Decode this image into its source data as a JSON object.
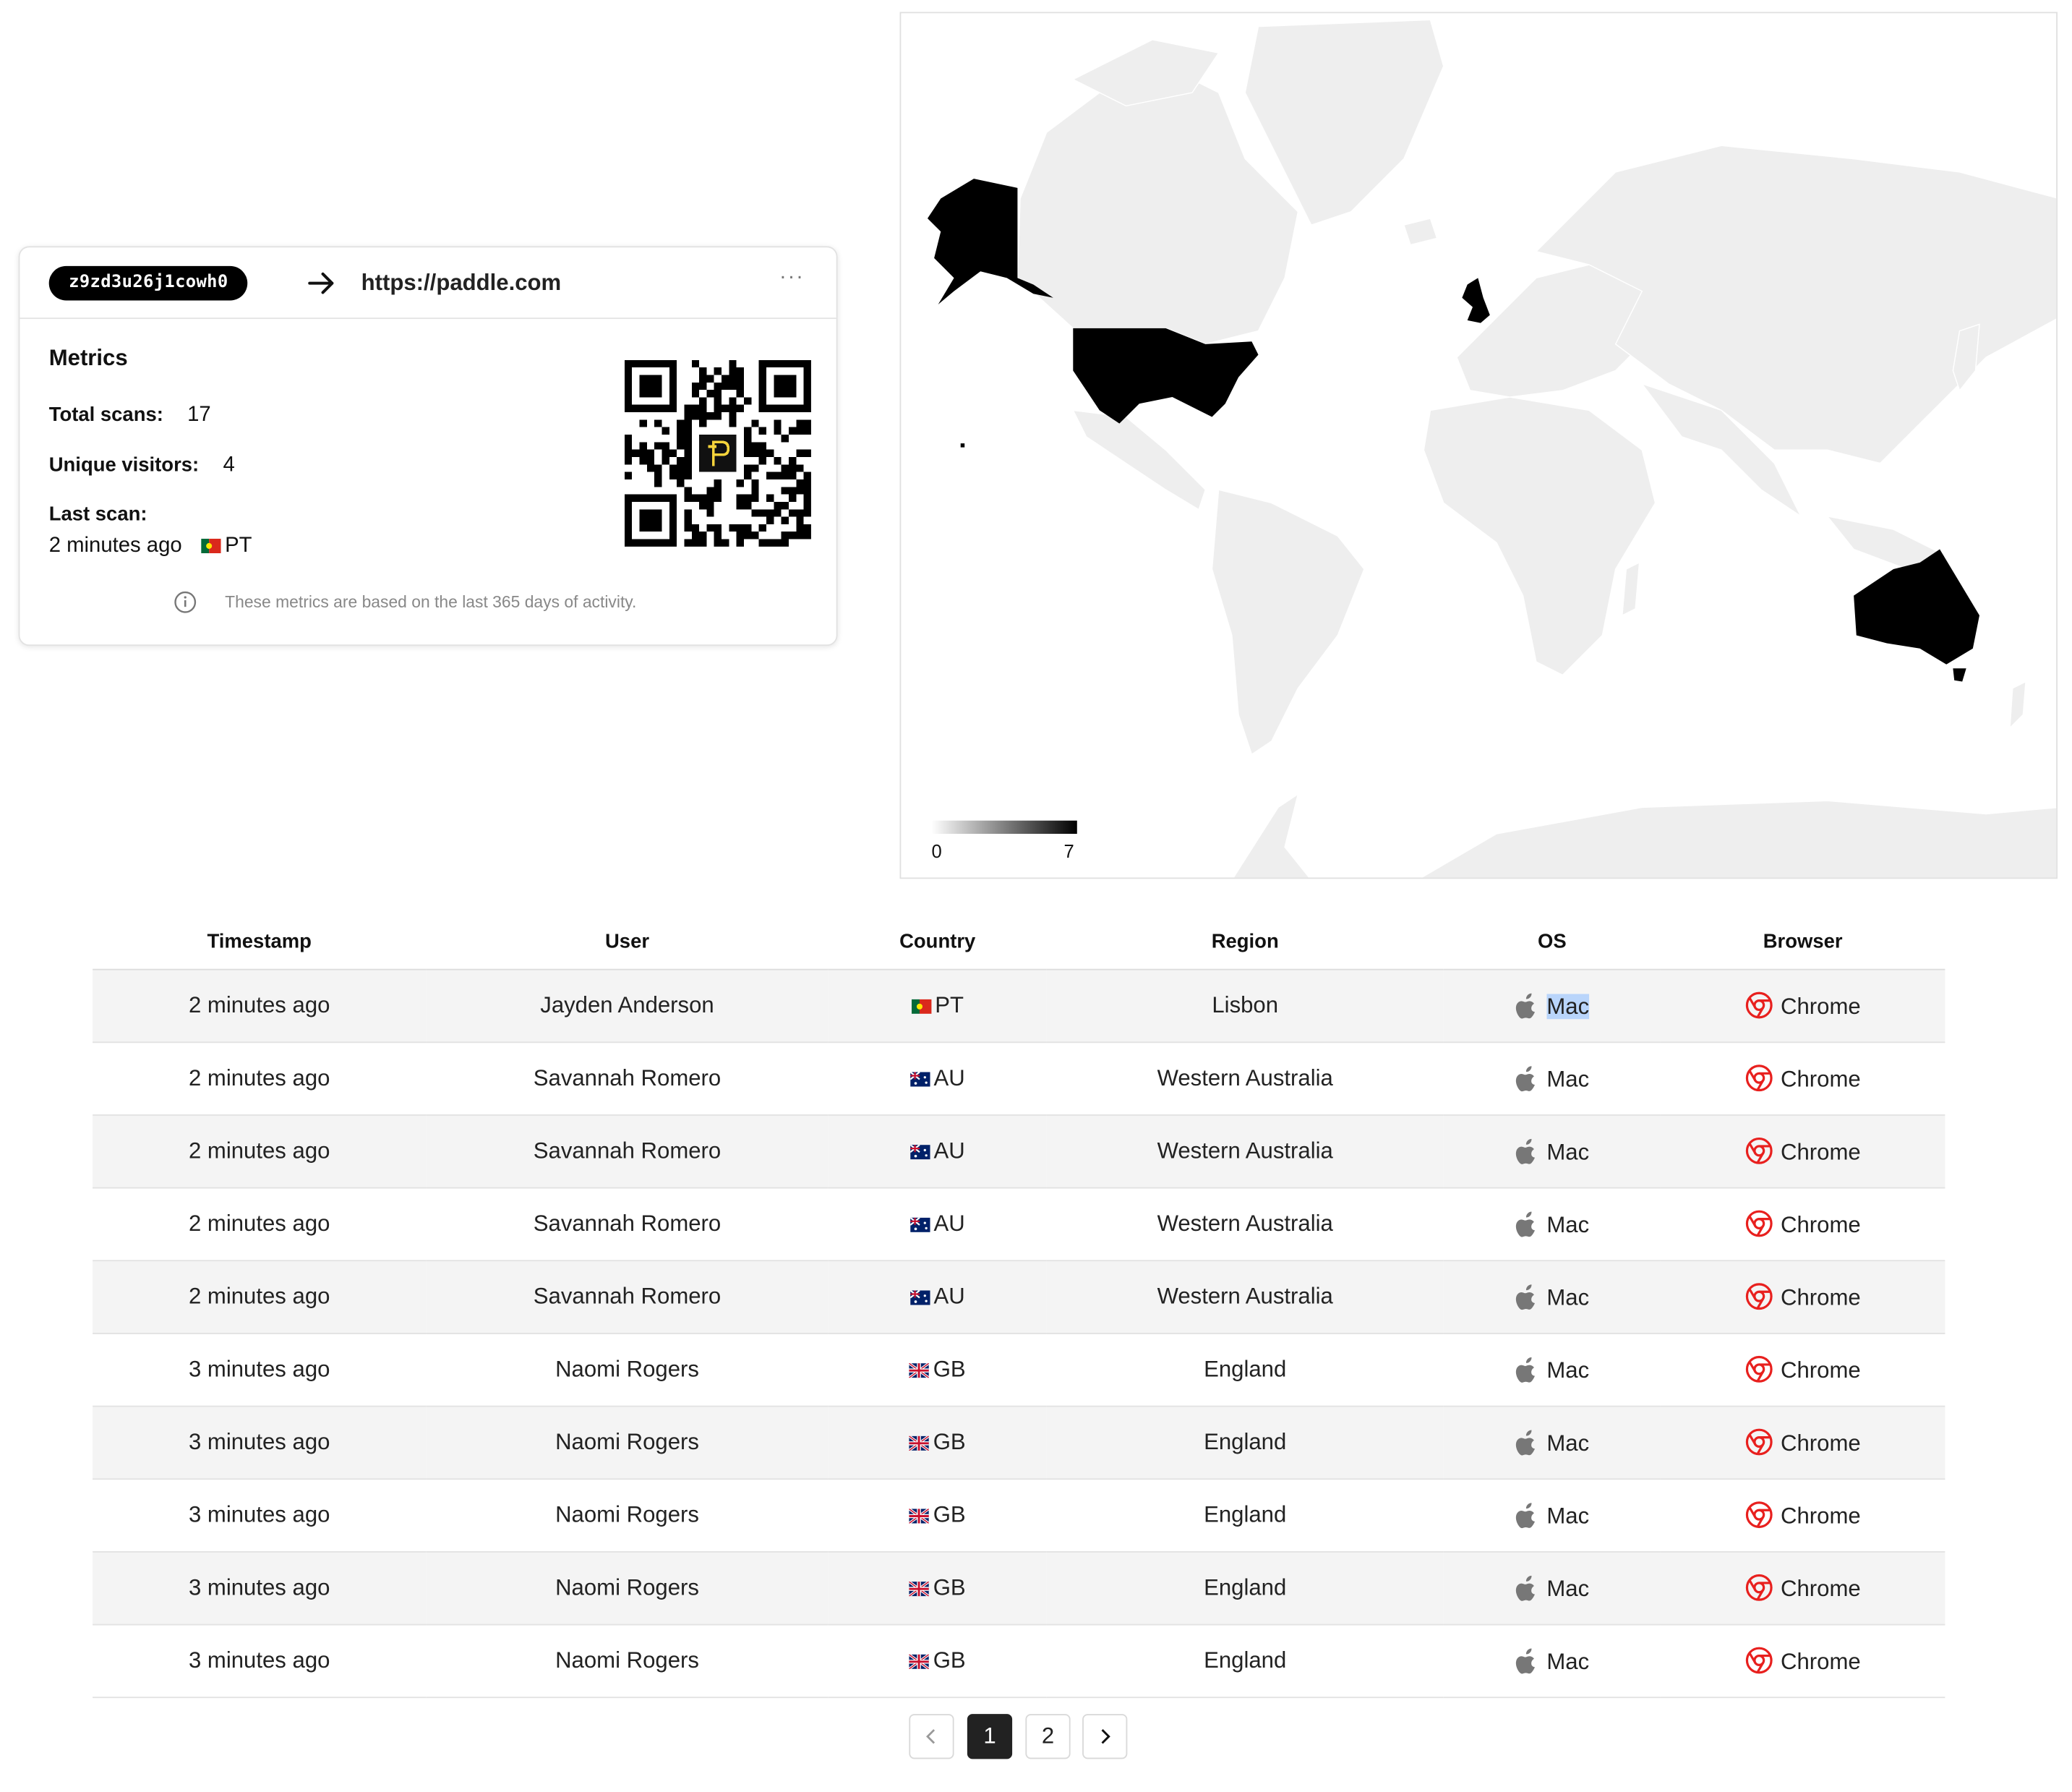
{
  "link": {
    "code": "z9zd3u26j1cowh0",
    "destination": "https://paddle.com",
    "more_label": "···"
  },
  "metrics": {
    "title": "Metrics",
    "total_scans_label": "Total scans:",
    "total_scans": "17",
    "unique_visitors_label": "Unique visitors:",
    "unique_visitors": "4",
    "last_scan_label": "Last scan:",
    "last_scan_time": "2 minutes ago",
    "last_scan_country": "PT",
    "note": "These metrics are based on the last 365 days of activity."
  },
  "map": {
    "legend_min": "0",
    "legend_max": "7",
    "highlighted_countries": [
      "US",
      "GB",
      "AU"
    ],
    "highlight_color": "#000000",
    "land_color": "#eeeeee"
  },
  "table": {
    "headers": [
      "Timestamp",
      "User",
      "Country",
      "Region",
      "OS",
      "Browser"
    ],
    "rows": [
      {
        "time": "2 minutes ago",
        "user": "Jayden Anderson",
        "country": "PT",
        "region": "Lisbon",
        "os": "Mac",
        "browser": "Chrome"
      },
      {
        "time": "2 minutes ago",
        "user": "Savannah Romero",
        "country": "AU",
        "region": "Western Australia",
        "os": "Mac",
        "browser": "Chrome"
      },
      {
        "time": "2 minutes ago",
        "user": "Savannah Romero",
        "country": "AU",
        "region": "Western Australia",
        "os": "Mac",
        "browser": "Chrome"
      },
      {
        "time": "2 minutes ago",
        "user": "Savannah Romero",
        "country": "AU",
        "region": "Western Australia",
        "os": "Mac",
        "browser": "Chrome"
      },
      {
        "time": "2 minutes ago",
        "user": "Savannah Romero",
        "country": "AU",
        "region": "Western Australia",
        "os": "Mac",
        "browser": "Chrome"
      },
      {
        "time": "3 minutes ago",
        "user": "Naomi Rogers",
        "country": "GB",
        "region": "England",
        "os": "Mac",
        "browser": "Chrome"
      },
      {
        "time": "3 minutes ago",
        "user": "Naomi Rogers",
        "country": "GB",
        "region": "England",
        "os": "Mac",
        "browser": "Chrome"
      },
      {
        "time": "3 minutes ago",
        "user": "Naomi Rogers",
        "country": "GB",
        "region": "England",
        "os": "Mac",
        "browser": "Chrome"
      },
      {
        "time": "3 minutes ago",
        "user": "Naomi Rogers",
        "country": "GB",
        "region": "England",
        "os": "Mac",
        "browser": "Chrome"
      },
      {
        "time": "3 minutes ago",
        "user": "Naomi Rogers",
        "country": "GB",
        "region": "England",
        "os": "Mac",
        "browser": "Chrome"
      }
    ]
  },
  "pagination": {
    "pages": [
      "1",
      "2"
    ],
    "current": "1"
  },
  "colors": {
    "chrome_red": "#e8201e",
    "os_icon_grey": "#777777",
    "selection_blue": "#b9d5fb"
  }
}
